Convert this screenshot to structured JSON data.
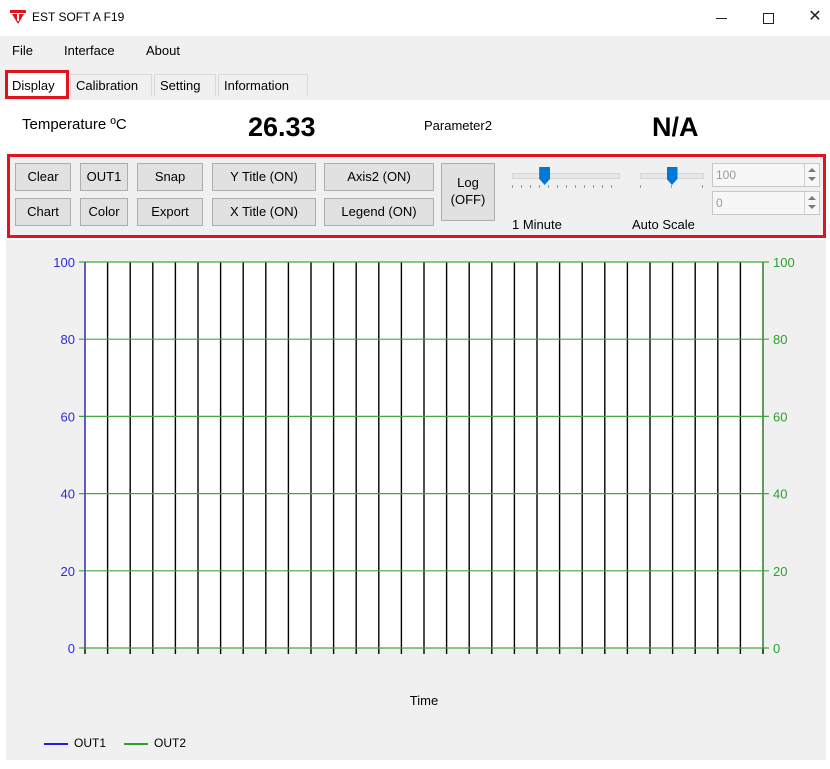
{
  "window": {
    "title": "EST SOFT A F19",
    "brand_color": "#e0141e"
  },
  "menu": [
    {
      "label": "File"
    },
    {
      "label": "Interface"
    },
    {
      "label": "About"
    }
  ],
  "tabs": [
    {
      "label": "Display",
      "active": true
    },
    {
      "label": "Calibration",
      "active": false
    },
    {
      "label": "Setting",
      "active": false
    },
    {
      "label": "Information",
      "active": false
    }
  ],
  "readouts": {
    "temperature_label": "Temperature ºC",
    "temperature_value": "26.33",
    "parameter_label": "Parameter2",
    "parameter_value": "N/A"
  },
  "toolbar": {
    "clear": "Clear",
    "out1": "OUT1",
    "snap": "Snap",
    "y_title": "Y Title (ON)",
    "axis2": "Axis2 (ON)",
    "chart": "Chart",
    "color": "Color",
    "export": "Export",
    "x_title": "X Title (ON)",
    "legend": "Legend (ON)",
    "log_line1": "Log",
    "log_line2": "(OFF)",
    "time_slider_label": "1 Minute",
    "time_slider_level": 0.28,
    "scale_slider_label": "Auto Scale",
    "scale_slider_level": 0.5,
    "max_value": "100",
    "min_value": "0"
  },
  "chart_data": {
    "type": "line",
    "xlabel": "Time",
    "ylabel": "",
    "ylim": [
      0,
      100
    ],
    "y2lim": [
      0,
      100
    ],
    "yticks": [
      0,
      20,
      40,
      60,
      80,
      100
    ],
    "vertical_gridlines": 31,
    "grid": true,
    "legend_position": "bottom-left",
    "series": [
      {
        "name": "OUT1",
        "color": "#1f1fe0",
        "values": []
      },
      {
        "name": "OUT2",
        "color": "#2ca02c",
        "values": []
      }
    ],
    "colors": {
      "left_axis": "#2b2bd8",
      "right_axis": "#2ca02c",
      "horizontal_grid": "#43a843",
      "vertical_grid": "#000000"
    }
  }
}
